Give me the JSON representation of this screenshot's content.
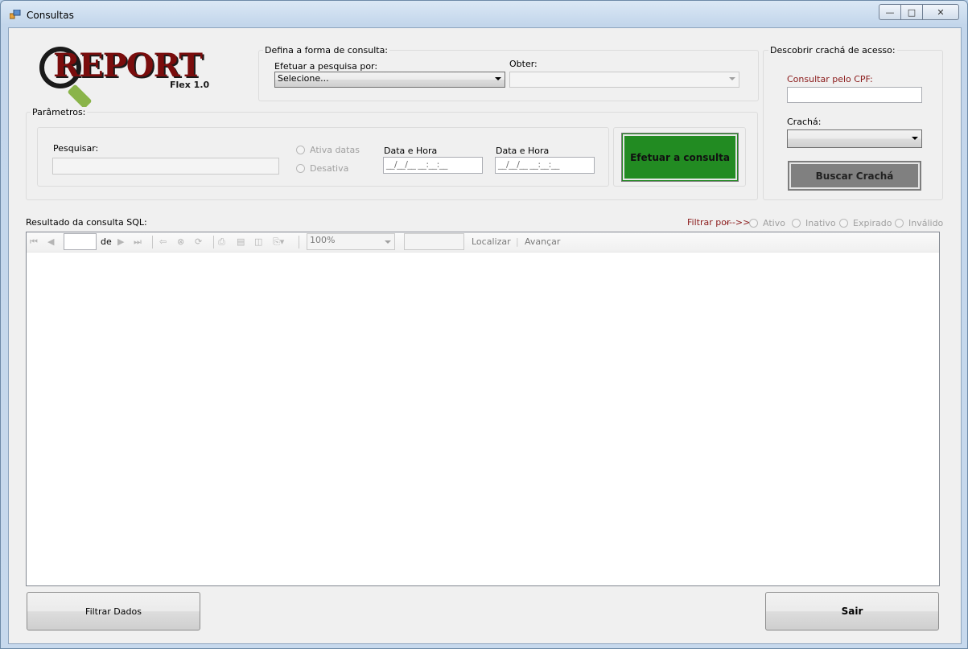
{
  "window": {
    "title": "Consultas",
    "minimize": "—",
    "maximize": "□",
    "close": "✕"
  },
  "logo": {
    "main": "REPORT",
    "sub": "Flex 1.0"
  },
  "consulta_group": {
    "label": "Defina a forma de consulta:",
    "pesquisa_label": "Efetuar a pesquisa por:",
    "pesquisa_value": "Selecione...",
    "obter_label": "Obter:",
    "obter_value": ""
  },
  "cracha_group": {
    "label": "Descobrir crachá de acesso:",
    "cpf_label": "Consultar pelo CPF:",
    "cpf_value": "",
    "cracha_label": "Crachá:",
    "cracha_value": "",
    "buscar_button": "Buscar Crachá"
  },
  "parametros_group": {
    "label": "Parâmetros:",
    "pesquisar_label": "Pesquisar:",
    "pesquisar_value": "",
    "ativa_datas": "Ativa datas",
    "desativa": "Desativa",
    "data_hora_1_label": "Data e Hora",
    "data_hora_1_value": "__/__/__ __:__:__",
    "data_hora_2_label": "Data e Hora",
    "data_hora_2_value": "__/__/__ __:__:__",
    "efetuar_button": "Efetuar a consulta"
  },
  "resultado": {
    "label": "Resultado da consulta SQL:",
    "filtrar_por": "Filtrar por",
    "arrow": "--->>",
    "filters": [
      "Ativo",
      "Inativo",
      "Expirado",
      "Inválido"
    ]
  },
  "report_toolbar": {
    "page_value": "",
    "de_label": "de",
    "zoom_value": "100%",
    "search_value": "",
    "localizar": "Localizar",
    "separator": "|",
    "avancar": "Avançar"
  },
  "footer": {
    "filtrar_button": "Filtrar Dados",
    "sair_button": "Sair"
  },
  "colors": {
    "green_button": "#228b22",
    "gray_button": "#808080",
    "logo_red": "#7a0d0d",
    "cpf_label": "#8b1a1a",
    "filter_label": "#8b1a1a"
  }
}
